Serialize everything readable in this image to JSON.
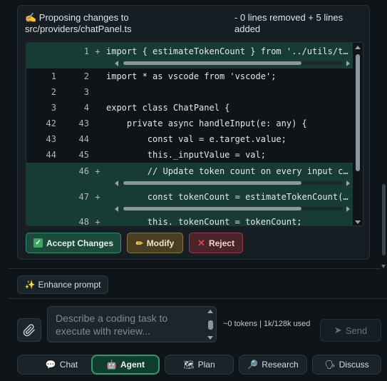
{
  "header": {
    "proposing_icon": "writing-hand-icon",
    "proposing_text": "✍️ Proposing changes to src/providers/chatPanel.ts",
    "summary": "- 0 lines removed + 5 lines added"
  },
  "diff": {
    "rows": [
      {
        "old": "",
        "new": "1",
        "sign": "+",
        "code": "import { estimateTokenCount } from '../utils/tokenizer';",
        "added": true
      },
      {
        "old": "1",
        "new": "2",
        "sign": "",
        "code": "import * as vscode from 'vscode';",
        "added": false
      },
      {
        "old": "2",
        "new": "3",
        "sign": "",
        "code": "",
        "added": false
      },
      {
        "old": "3",
        "new": "4",
        "sign": "",
        "code": "export class ChatPanel {",
        "added": false
      },
      {
        "old": "42",
        "new": "43",
        "sign": "",
        "code": "    private async handleInput(e: any) {",
        "added": false
      },
      {
        "old": "43",
        "new": "44",
        "sign": "",
        "code": "        const val = e.target.value;",
        "added": false
      },
      {
        "old": "44",
        "new": "45",
        "sign": "",
        "code": "        this._inputValue = val;",
        "added": false
      },
      {
        "old": "",
        "new": "46",
        "sign": "+",
        "code": "        // Update token count on every input change",
        "added": true
      },
      {
        "old": "",
        "new": "47",
        "sign": "+",
        "code": "        const tokenCount = estimateTokenCount(val);",
        "added": true
      },
      {
        "old": "",
        "new": "48",
        "sign": "+",
        "code": "        this._tokenCount = tokenCount;",
        "added": true
      }
    ]
  },
  "actions": {
    "accept": "Accept Changes",
    "modify": "Modify",
    "reject": "Reject"
  },
  "enhance_prompt": "Enhance prompt",
  "composer": {
    "placeholder": "Describe a coding task to execute with review...",
    "tokens": "~0 tokens | 1k/128k used",
    "send": "Send"
  },
  "modes": [
    {
      "label": "Chat",
      "icon": "speech-bubble-icon"
    },
    {
      "label": "Agent",
      "icon": "robot-icon",
      "active": true
    },
    {
      "label": "Plan",
      "icon": "map-icon"
    },
    {
      "label": "Research",
      "icon": "magnifier-icon"
    },
    {
      "label": "Discuss",
      "icon": "speaking-head-icon"
    }
  ],
  "colors": {
    "added_row": "#173c33",
    "accept": "#1c4b3c",
    "modify": "#4a3e22",
    "reject": "#4a2429",
    "active_mode": "#0f3d2e"
  }
}
